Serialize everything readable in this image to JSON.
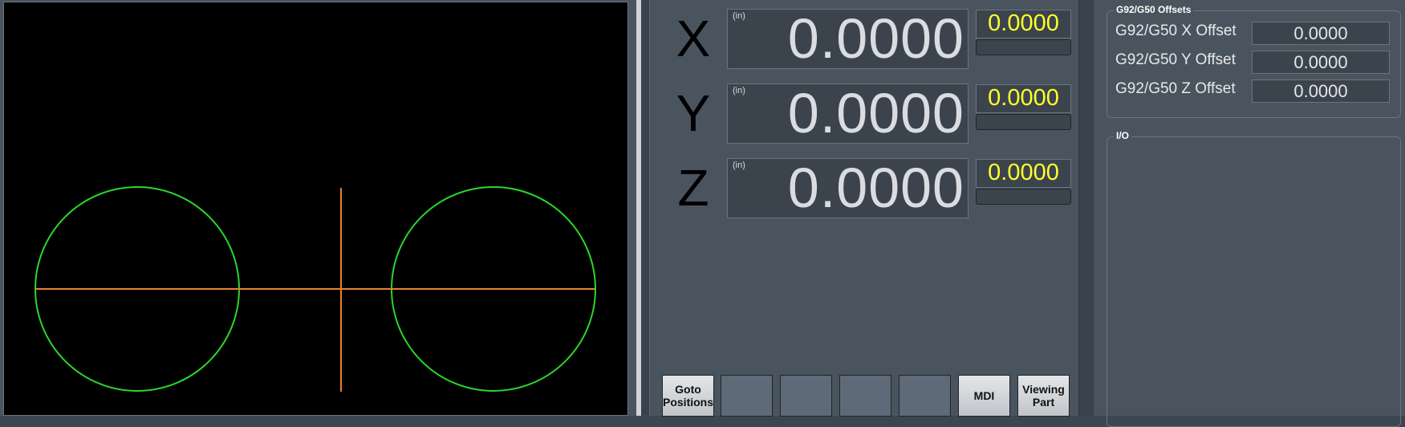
{
  "dro": {
    "x": {
      "letter": "X",
      "unit": "(in)",
      "value": "0.0000",
      "secondary": "0.0000"
    },
    "y": {
      "letter": "Y",
      "unit": "(in)",
      "value": "0.0000",
      "secondary": "0.0000"
    },
    "z": {
      "letter": "Z",
      "unit": "(in)",
      "value": "0.0000",
      "secondary": "0.0000"
    }
  },
  "buttons": {
    "goto_positions": "Goto\nPositions",
    "mdi": "MDI",
    "viewing_part": "Viewing\nPart"
  },
  "offsets": {
    "title": "G92/G50 Offsets",
    "x_label": "G92/G50 X Offset",
    "x_value": "0.0000",
    "y_label": "G92/G50 Y Offset",
    "y_value": "0.0000",
    "z_label": "G92/G50 Z Offset",
    "z_value": "0.0000"
  },
  "io": {
    "title": "I/O"
  },
  "colors": {
    "toolpath_circle": "#2bd62b",
    "toolpath_line": "#e6822e",
    "secondary_value": "#ffff2a"
  }
}
